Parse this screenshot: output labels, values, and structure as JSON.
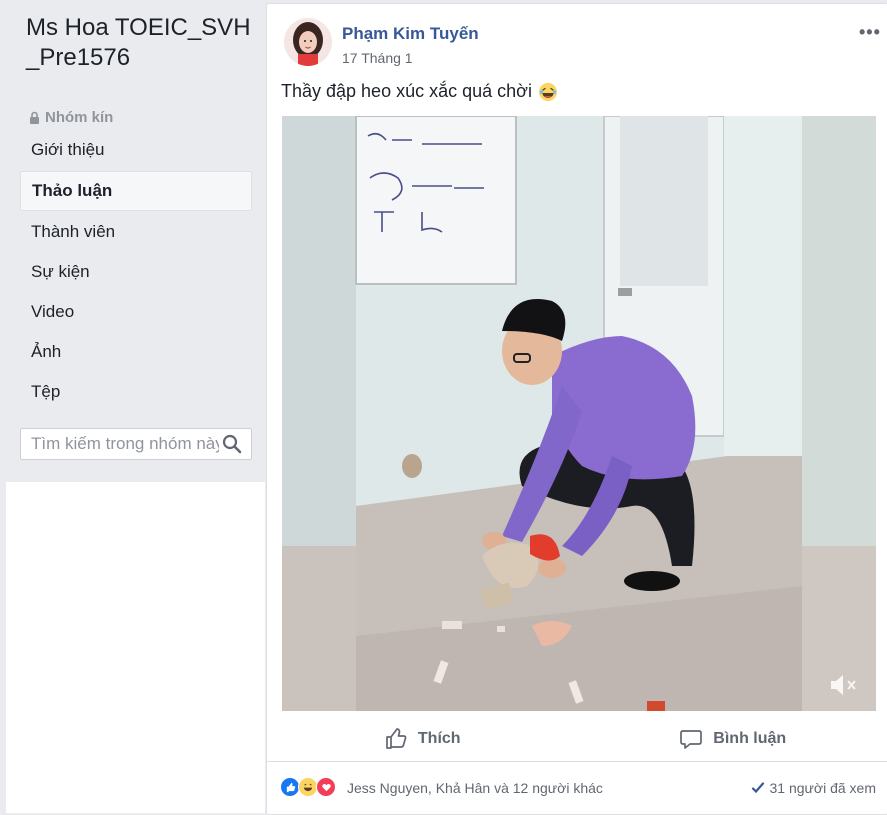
{
  "group": {
    "title": "Ms Hoa TOEIC_SVH_Pre1576",
    "privacy": "Nhóm kín"
  },
  "nav": {
    "items": [
      {
        "label": "Giới thiệu"
      },
      {
        "label": "Thảo luận"
      },
      {
        "label": "Thành viên"
      },
      {
        "label": "Sự kiện"
      },
      {
        "label": "Video"
      },
      {
        "label": "Ảnh"
      },
      {
        "label": "Tệp"
      }
    ],
    "active": "Thảo luận"
  },
  "search": {
    "placeholder": "Tìm kiếm trong nhóm này"
  },
  "post": {
    "author": "Phạm Kim Tuyến",
    "date": "17 Tháng 1",
    "text": "Thầy đập heo xúc xắc quá chời",
    "more": "•••",
    "actions": {
      "like": "Thích",
      "comment": "Bình luận"
    },
    "reactions": {
      "names": "Jess Nguyen, Khả Hân và 12 người khác",
      "icons": [
        "like-icon",
        "haha-icon",
        "love-icon"
      ],
      "seen": "31 người đã xem"
    }
  },
  "colors": {
    "link": "#385898",
    "background": "#e9ebee",
    "like_blue": "#1877f2",
    "love_red": "#f33e58",
    "haha_yellow": "#fcd462"
  }
}
